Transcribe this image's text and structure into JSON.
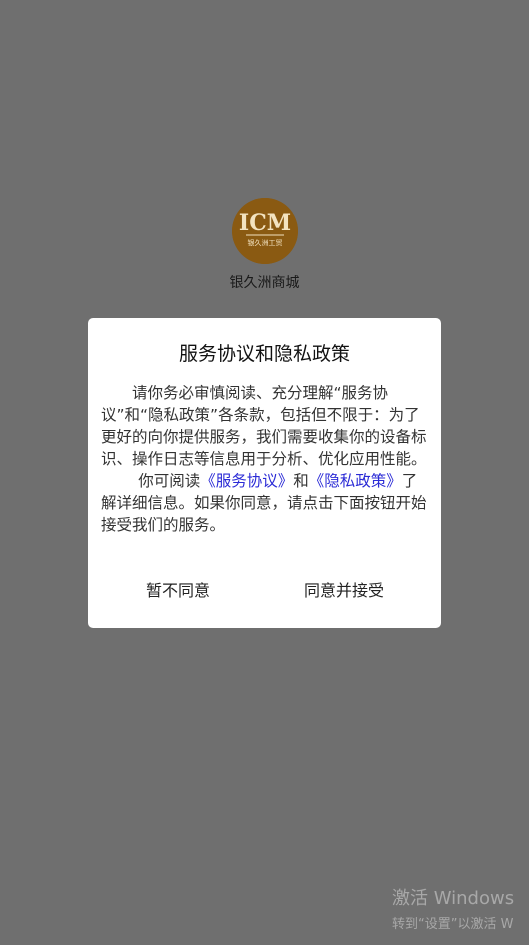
{
  "app": {
    "logo_text": "ICM",
    "logo_subtext": "银久洲工贸",
    "name": "银久洲商城"
  },
  "dialog": {
    "title": "服务协议和隐私政策",
    "para1": "请你务必审慎阅读、充分理解“服务协议”和“隐私政策”各条款，包括但不限于：为了更好的向你提供服务，我们需要收集你的设备标识、操作日志等信息用于分析、优化应用性能。",
    "para2_prefix": "你可阅读",
    "link_service": "《服务协议》",
    "para2_and": "和",
    "link_privacy": "《隐私政策》",
    "para2_suffix": "了解详细信息。如果你同意，请点击下面按钮开始接受我们的服务。",
    "disagree_label": "暂不同意",
    "agree_label": "同意并接受",
    "link_color": "#2b2bd6"
  },
  "watermark": {
    "line1": "激活 Windows",
    "line2": "转到“设置”以激活 W"
  }
}
